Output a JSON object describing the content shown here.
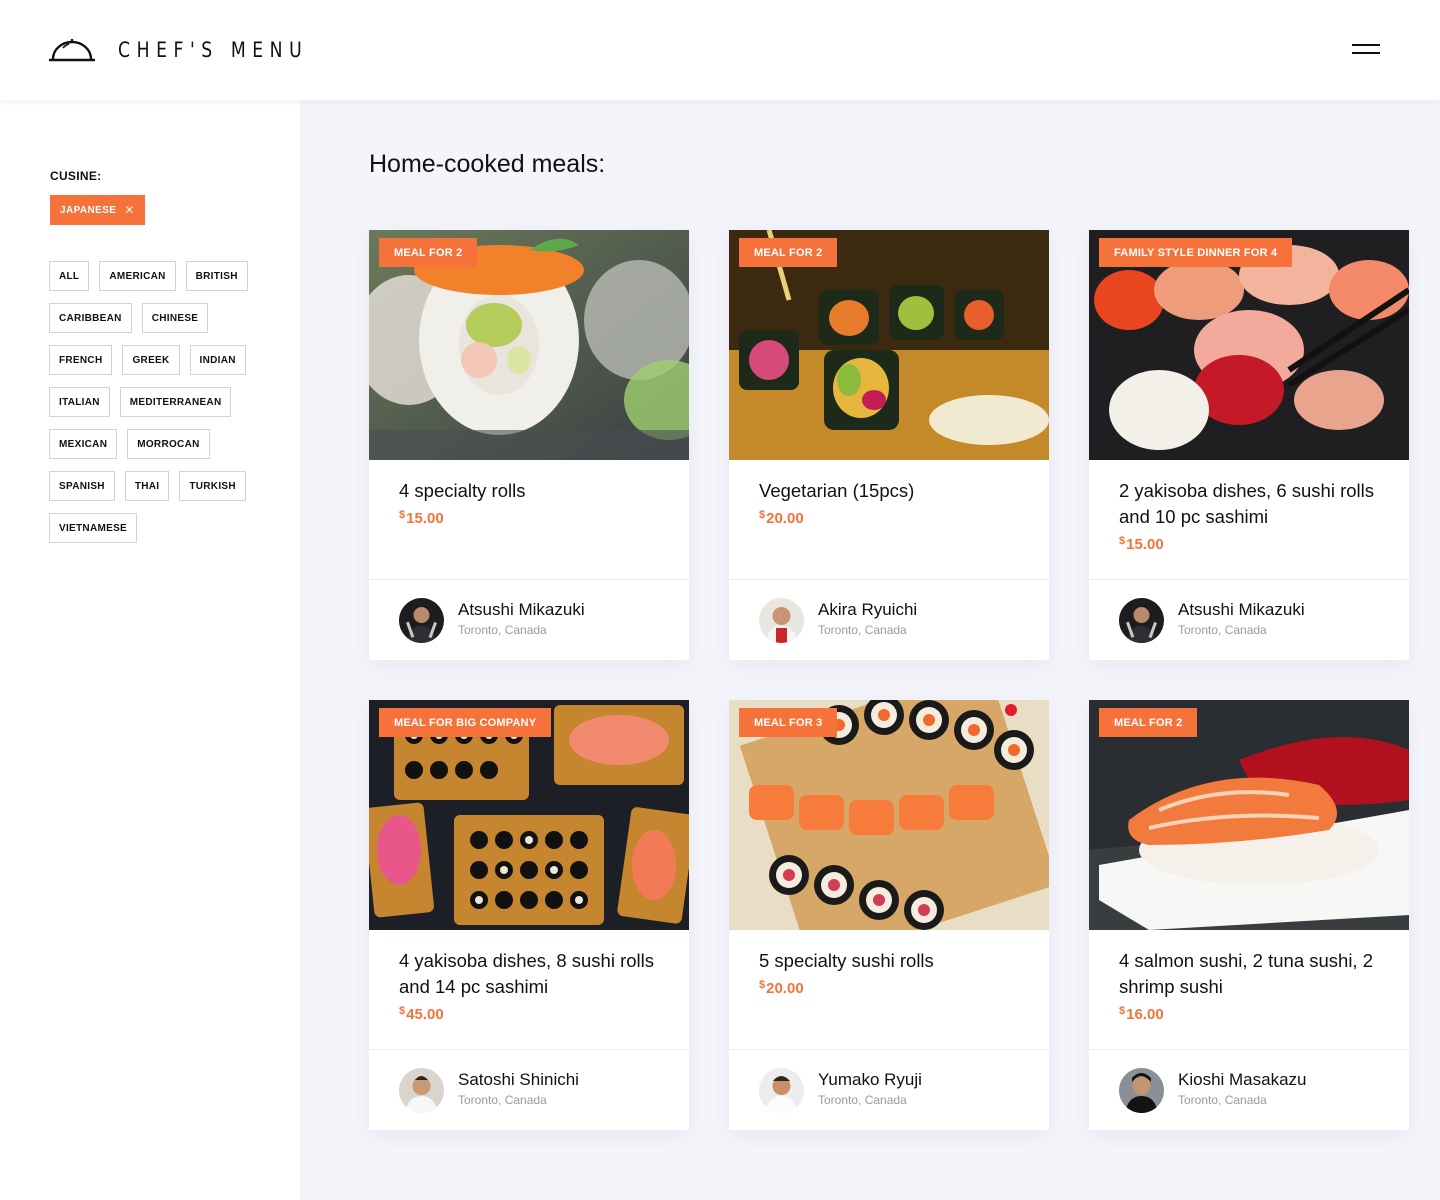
{
  "brand": {
    "name": "CHEF'S MENU"
  },
  "sidebar": {
    "filter_label": "CUSINE:",
    "active_filter": "JAPANESE",
    "tags": [
      "ALL",
      "AMERICAN",
      "BRITISH",
      "CARIBBEAN",
      "CHINESE",
      "FRENCH",
      "GREEK",
      "INDIAN",
      "ITALIAN",
      "MEDITERRANEAN",
      "MEXICAN",
      "MORROCAN",
      "SPANISH",
      "THAI",
      "TURKISH",
      "VIETNAMESE"
    ]
  },
  "main": {
    "title": "Home-cooked meals:",
    "cards": [
      {
        "badge": "MEAL FOR 2",
        "title": "4 specialty rolls",
        "currency": "$",
        "price": "15.00",
        "chef": "Atsushi Mikazuki",
        "location": "Toronto, Canada"
      },
      {
        "badge": "MEAL FOR 2",
        "title": "Vegetarian (15pcs)",
        "currency": "$",
        "price": "20.00",
        "chef": "Akira Ryuichi",
        "location": "Toronto, Canada"
      },
      {
        "badge": "FAMILY STYLE DINNER FOR 4",
        "title": "2 yakisoba dishes, 6 sushi rolls and 10 pc sashimi",
        "currency": "$",
        "price": "15.00",
        "chef": "Atsushi Mikazuki",
        "location": "Toronto, Canada"
      },
      {
        "badge": "MEAL FOR BIG COMPANY",
        "title": "4 yakisoba dishes, 8 sushi rolls and 14 pc sashimi",
        "currency": "$",
        "price": "45.00",
        "chef": "Satoshi Shinichi",
        "location": "Toronto, Canada"
      },
      {
        "badge": "MEAL FOR 3",
        "title": "5 specialty sushi rolls",
        "currency": "$",
        "price": "20.00",
        "chef": "Yumako Ryuji",
        "location": "Toronto, Canada"
      },
      {
        "badge": "MEAL FOR 2",
        "title": "4 salmon sushi, 2 tuna sushi, 2 shrimp sushi",
        "currency": "$",
        "price": "16.00",
        "chef": "Kioshi Masakazu",
        "location": "Toronto, Canada"
      }
    ]
  },
  "colors": {
    "accent": "#f5733a",
    "background": "#f4f5fb"
  }
}
